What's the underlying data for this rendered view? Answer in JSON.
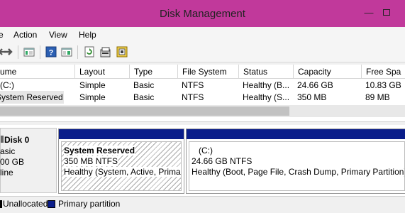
{
  "window": {
    "title": "Disk Management",
    "minimize_glyph": "—"
  },
  "menu": [
    "Action",
    "View",
    "Help"
  ],
  "toolbar": {
    "icons": [
      "back-arrow-icon",
      "forward-arrow-icon",
      "console-tree-icon",
      "help-icon",
      "properties-icon",
      "refresh-icon",
      "disk-properties-icon",
      "settings-icon"
    ]
  },
  "volume_list": {
    "columns": [
      "ume",
      "Layout",
      "Type",
      "File System",
      "Status",
      "Capacity",
      "Free Spa"
    ],
    "rows": [
      [
        "(C:)",
        "Simple",
        "Basic",
        "NTFS",
        "Healthy (B...",
        "24.66 GB",
        "10.83 GB"
      ],
      [
        "System Reserved",
        "Simple",
        "Basic",
        "NTFS",
        "Healthy (S...",
        "350 MB",
        "89 MB"
      ]
    ]
  },
  "disk": {
    "name": "Disk 0",
    "type": "asic",
    "size": "00 GB",
    "status": "line"
  },
  "partitions": [
    {
      "name": "System Reserved",
      "size": "350 MB NTFS",
      "status": "Healthy (System, Active, Primar"
    },
    {
      "name": "(C:)",
      "size": "24.66 GB NTFS",
      "status": "Healthy (Boot, Page File, Crash Dump, Primary Partition)"
    }
  ],
  "legend": {
    "items": [
      {
        "label": "Unallocated",
        "color": "#000000"
      },
      {
        "label": "Primary partition",
        "color": "#0a1d8a"
      }
    ]
  },
  "colors": {
    "titlebar": "#c1399b",
    "partition_bar": "#0a1d8a"
  }
}
